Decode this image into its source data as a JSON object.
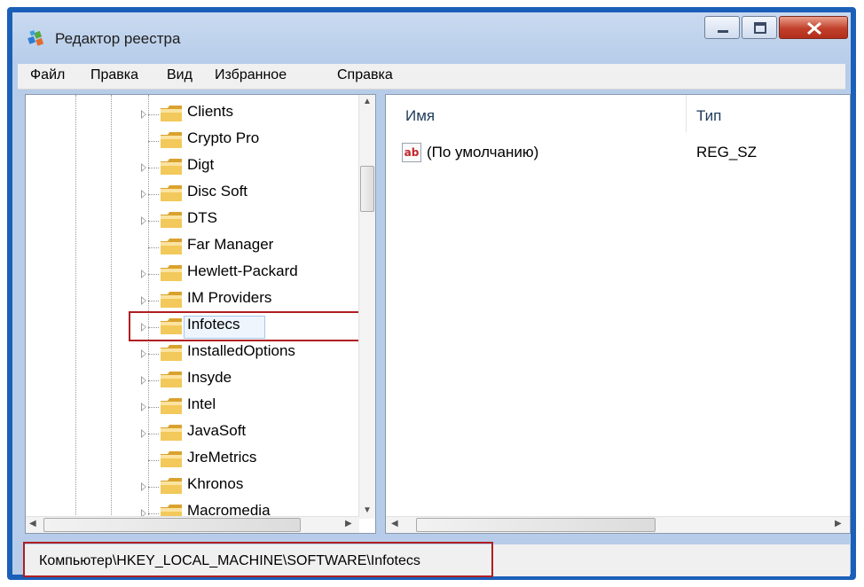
{
  "window": {
    "title": "Редактор реестра"
  },
  "menu": [
    "Файл",
    "Правка",
    "Вид",
    "Избранное",
    "Справка"
  ],
  "tree": {
    "items": [
      {
        "label": "Clients",
        "expandable": true
      },
      {
        "label": "Crypto Pro",
        "expandable": false
      },
      {
        "label": "Digt",
        "expandable": true
      },
      {
        "label": "Disc Soft",
        "expandable": true
      },
      {
        "label": "DTS",
        "expandable": true
      },
      {
        "label": "Far Manager",
        "expandable": false
      },
      {
        "label": "Hewlett-Packard",
        "expandable": true
      },
      {
        "label": "IM Providers",
        "expandable": true
      },
      {
        "label": "Infotecs",
        "expandable": true,
        "selected": true
      },
      {
        "label": "InstalledOptions",
        "expandable": true
      },
      {
        "label": "Insyde",
        "expandable": true
      },
      {
        "label": "Intel",
        "expandable": true
      },
      {
        "label": "JavaSoft",
        "expandable": true
      },
      {
        "label": "JreMetrics",
        "expandable": false
      },
      {
        "label": "Khronos",
        "expandable": true
      },
      {
        "label": "Macromedia",
        "expandable": true
      }
    ]
  },
  "list": {
    "columns": [
      "Имя",
      "Тип"
    ],
    "rows": [
      {
        "name": "(По умолчанию)",
        "type": "REG_SZ",
        "icon": "string-value-icon"
      }
    ]
  },
  "status": {
    "path": "Компьютер\\HKEY_LOCAL_MACHINE\\SOFTWARE\\Infotecs"
  },
  "colors": {
    "frame": "#1b5fb8",
    "highlight": "#b01e22",
    "folder": "#e8b63a"
  }
}
